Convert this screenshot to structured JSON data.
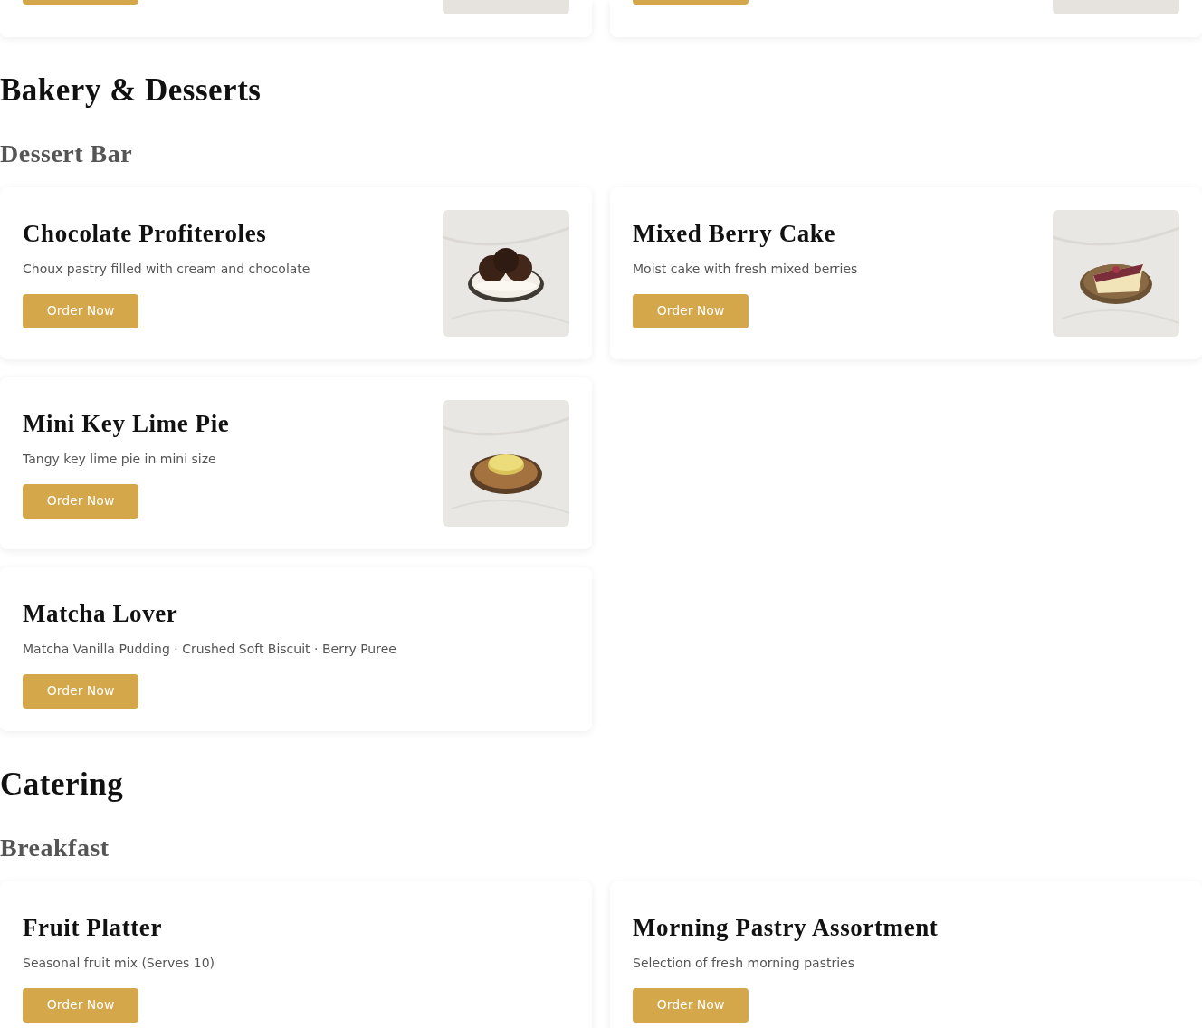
{
  "top_cards": [
    {
      "has_picture": true
    },
    {
      "has_picture": true
    }
  ],
  "sections": [
    {
      "title": "Bakery & Desserts",
      "groups": [
        {
          "title": "Dessert Bar",
          "rows": [
            [
              {
                "name": "Chocolate Profiteroles",
                "description": "Choux pastry filled with cream and chocolate",
                "button": "Order Now",
                "has_picture": true
              },
              {
                "name": "Mixed Berry Cake",
                "description": "Moist cake with fresh mixed berries",
                "button": "Order Now",
                "has_picture": true
              }
            ],
            [
              {
                "name": "Mini Key Lime Pie",
                "description": "Tangy key lime pie in mini size",
                "button": "Order Now",
                "has_picture": true
              }
            ],
            [
              {
                "name": "Matcha Lover",
                "description": "Matcha Vanilla Pudding · Crushed Soft Biscuit · Berry Puree",
                "button": "Order Now",
                "has_picture": false
              }
            ]
          ]
        }
      ]
    },
    {
      "title": "Catering",
      "groups": [
        {
          "title": "Breakfast",
          "rows": [
            [
              {
                "name": "Fruit Platter",
                "description": "Seasonal fruit mix (Serves 10)",
                "button": "Order Now",
                "has_picture": false
              },
              {
                "name": "Morning Pastry Assortment",
                "description": "Selection of fresh morning pastries",
                "button": "Order Now",
                "has_picture": false
              }
            ]
          ]
        }
      ]
    }
  ]
}
